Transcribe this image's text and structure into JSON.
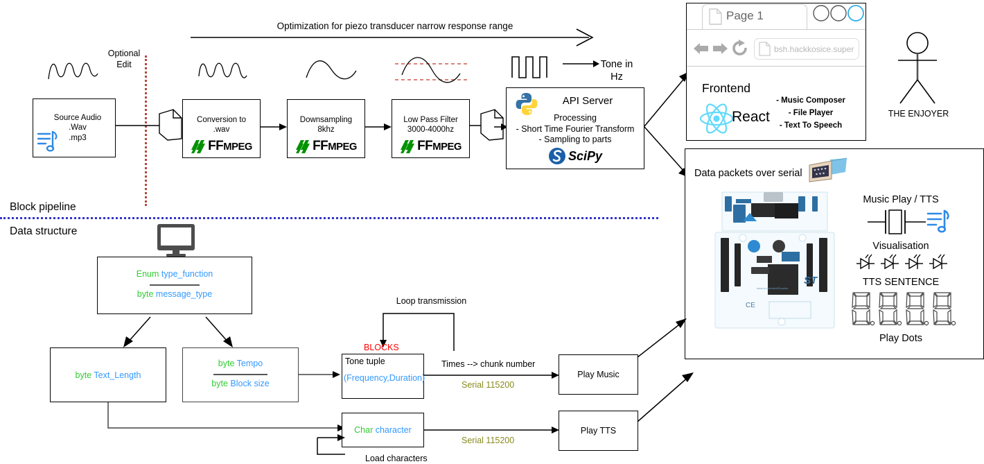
{
  "diagram": {
    "top_arrow_label": "Optimization for piezo transducer narrow response range",
    "optional_edit_label_line1": "Optional",
    "optional_edit_label_line2": "Edit",
    "tone_label_line1": "Tone in",
    "tone_label_line2": "Hz",
    "section_labels": {
      "block_pipeline": "Block pipeline",
      "data_structure": "Data structure"
    }
  },
  "pipeline": {
    "source": {
      "title": "Source Audio",
      "line2": ".Wav",
      "line3": ".mp3",
      "icon": "music-note-icon"
    },
    "conversion": {
      "line1": "Conversion to",
      "line2": ".wav",
      "logo": "ffmpeg-logo",
      "logo_text_bold": "FF",
      "logo_text_small": "MPEG"
    },
    "downsampling": {
      "line1": "Downsampling",
      "line2": "8khz",
      "logo": "ffmpeg-logo",
      "logo_text_bold": "FF",
      "logo_text_small": "MPEG"
    },
    "lowpass": {
      "line1": "Low Pass Filter",
      "line2": "3000-4000hz",
      "logo": "ffmpeg-logo",
      "logo_text_bold": "FF",
      "logo_text_small": "MPEG"
    },
    "api_server": {
      "title": "API Server",
      "subtitle": "Processing",
      "bullet1": "- Short Time Fourier Transform",
      "bullet2": "- Sampling to parts",
      "python_logo": "python-logo",
      "scipy_logo": "scipy-logo",
      "scipy_text": "SciPy"
    }
  },
  "browser": {
    "tab_label": "Page 1",
    "tab_icon": "page-icon",
    "back_icon": "arrow-left-icon",
    "forward_icon": "arrow-right-icon",
    "reload_icon": "reload-icon",
    "url_icon": "page-icon",
    "url_value": "bsh.hackkosice.super",
    "frontend_title": "Frontend",
    "react_logo": "react-logo",
    "react_label": "React",
    "features": [
      "- Music Composer",
      "- File Player",
      "- Text To Speech"
    ],
    "window_buttons": [
      "circle-button-1",
      "circle-button-2",
      "circle-button-3"
    ]
  },
  "actor": {
    "label": "THE ENJOYER",
    "icon": "stick-figure-icon"
  },
  "device_panel": {
    "serial_label": "Data packets over serial",
    "serial_icon": "db9-connector-icon",
    "board_icon": "stm32-nucleo-board-icon",
    "music_play_title": "Music Play / TTS",
    "music_note_icon": "music-note-icon",
    "buzzer_icon": "piezo-buzzer-icon",
    "visualisation_title": "Visualisation",
    "led_icons": [
      "led-icon",
      "led-icon",
      "led-icon",
      "led-icon"
    ],
    "tts_sentence_title": "TTS SENTENCE",
    "seven_segment_icons": [
      "seven-segment-digit",
      "seven-segment-digit",
      "seven-segment-digit",
      "seven-segment-digit"
    ],
    "play_dots_title": "Play Dots"
  },
  "data_structure": {
    "monitor_icon": "monitor-icon",
    "root": {
      "field1_type": "Enum",
      "field1_name": "type_function",
      "field2_type": "byte",
      "field2_name": "message_type"
    },
    "text_length": {
      "type": "byte",
      "name": "Text_Length"
    },
    "tempo_block": {
      "field1_type": "byte",
      "field1_name": "Tempo",
      "field2_type": "byte",
      "field2_name": "Block size"
    },
    "blocks_label": "BLOCKS",
    "tone_tuple": {
      "title": "Tone tuple",
      "value": "(Frequency,Duration)"
    },
    "loop_transmission_label": "Loop transmission",
    "times_chunk_label": "Times -->  chunk number",
    "serial_music_label": "Serial 115200",
    "char_block": {
      "type": "Char",
      "name": "character"
    },
    "load_characters_label": "Load characters",
    "serial_tts_label": "Serial 115200",
    "play_music_label": "Play Music",
    "play_tts_label": "Play TTS"
  },
  "colors": {
    "green": "#33cc33",
    "blue": "#3399ff",
    "red": "#ff0000",
    "olive": "#8a8a1f",
    "dotted_red": "#b5483d",
    "dotted_blue": "#3333cc",
    "react_cyan": "#61dafb",
    "ffmpeg_green": "#029200"
  }
}
